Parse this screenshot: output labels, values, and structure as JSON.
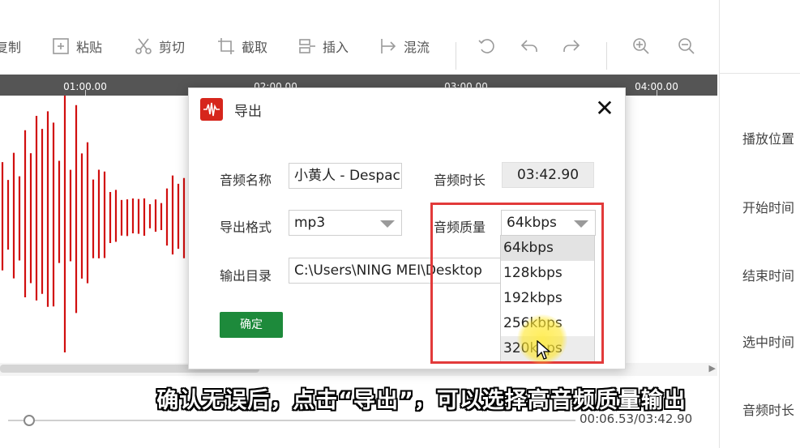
{
  "toolbar": {
    "items": [
      {
        "label": "复制",
        "icon": "copy-icon"
      },
      {
        "label": "粘贴",
        "icon": "paste-icon"
      },
      {
        "label": "剪切",
        "icon": "scissors-icon"
      },
      {
        "label": "截取",
        "icon": "crop-icon"
      },
      {
        "label": "插入",
        "icon": "insert-icon"
      },
      {
        "label": "混流",
        "icon": "mix-icon"
      }
    ],
    "icon_buttons": [
      "loop-icon",
      "undo-icon",
      "redo-icon",
      "zoom-in-icon",
      "zoom-out-icon"
    ]
  },
  "ruler": {
    "labels": [
      "01:00.00",
      "02:00.00",
      "03:00.00",
      "04:00.00"
    ]
  },
  "waveform": {
    "color": "#d10f0f"
  },
  "right_panel": {
    "labels": [
      "播放位置",
      "开始时间",
      "结束时间",
      "选中时间",
      "音频时长"
    ]
  },
  "playback": {
    "time": "00:06.53/03:42.90"
  },
  "dialog": {
    "title": "导出",
    "icon": "waveform-logo-icon",
    "close": "✕",
    "name_label": "音频名称",
    "name_value": "小黄人 - Despacito",
    "duration_label": "音频时长",
    "duration_value": "03:42.90",
    "format_label": "导出格式",
    "format_value": "mp3",
    "quality_label": "音频质量",
    "quality_value": "64kbps",
    "output_label": "输出目录",
    "output_value": "C:\\Users\\NING MEI\\Desktop",
    "ok_label": "确定",
    "quality_options": [
      "64kbps",
      "128kbps",
      "192kbps",
      "256kbps",
      "320kbps"
    ]
  },
  "subtitle": "确认无误后，点击“导出”，可以选择高音频质量输出",
  "colors": {
    "accent_red": "#e23a3a",
    "ok_green": "#1d8a3b",
    "brand_red": "#d6261c"
  }
}
